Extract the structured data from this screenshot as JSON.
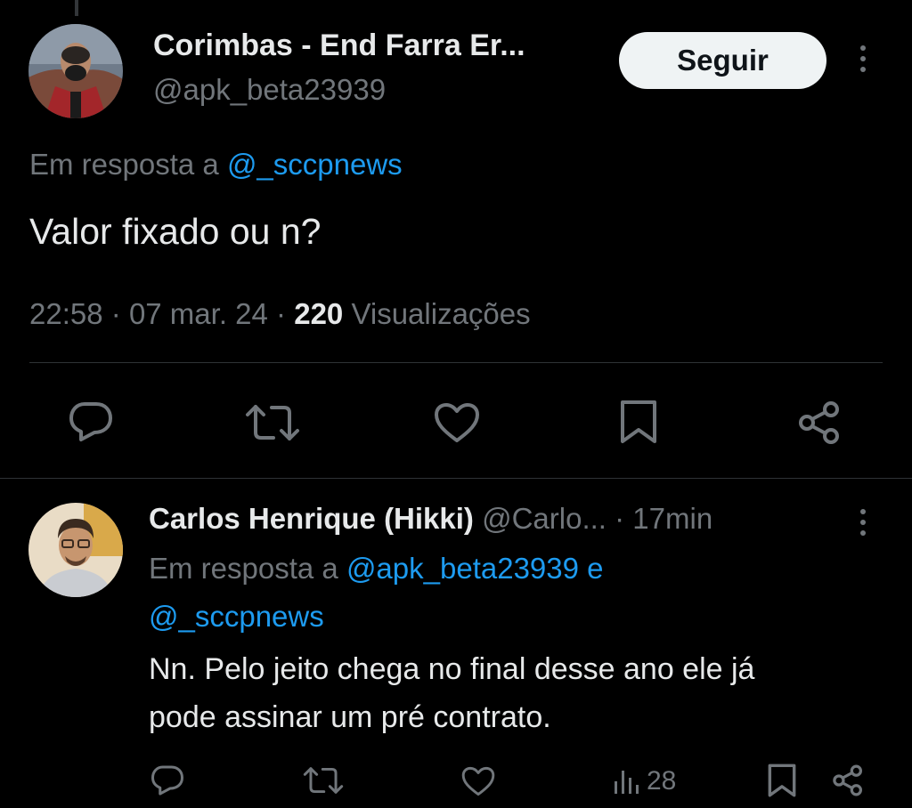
{
  "main_tweet": {
    "author_name": "Corimbas - End Farra Er...",
    "author_handle": "@apk_beta23939",
    "follow_label": "Seguir",
    "reply_prefix": "Em resposta a",
    "reply_to": "@_sccpnews",
    "text": "Valor fixado ou n?",
    "time": "22:58",
    "sep1": "·",
    "date": "07 mar. 24",
    "sep2": "·",
    "views_count": "220",
    "views_label": "Visualizações",
    "actions": {
      "reply_icon": "reply-icon",
      "retweet_icon": "retweet-icon",
      "like_icon": "heart-icon",
      "bookmark_icon": "bookmark-icon",
      "share_icon": "share-icon"
    }
  },
  "reply_tweet": {
    "author_name": "Carlos Henrique (Hikki)",
    "author_handle": "@Carlo...",
    "time": "· 17min",
    "reply_prefix": "Em resposta a",
    "reply_to_1": "@apk_beta23939 e",
    "reply_to_2": "@_sccpnews",
    "text_line1": "Nn. Pelo jeito chega no final desse ano ele já",
    "text_line2": "pode assinar um pré contrato.",
    "views": "28"
  },
  "colors": {
    "background": "#000000",
    "text": "#e7e9ea",
    "secondary": "#71767b",
    "link": "#1d9bf0",
    "follow_bg": "#eff3f4",
    "divider": "#2f3336"
  }
}
